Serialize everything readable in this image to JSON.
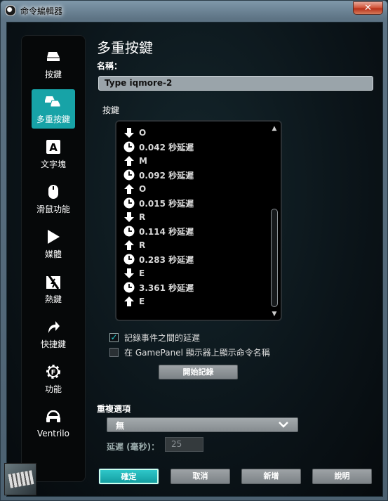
{
  "window": {
    "title": "命令編輯器",
    "close_label": "✕"
  },
  "sidebar": {
    "items": [
      {
        "label": "按鍵",
        "icon": "key-icon",
        "active": false
      },
      {
        "label": "多重按鍵",
        "icon": "multikey-icon",
        "active": true
      },
      {
        "label": "文字塊",
        "icon": "text-block-icon",
        "active": false
      },
      {
        "label": "滑鼠功能",
        "icon": "mouse-icon",
        "active": false
      },
      {
        "label": "媒體",
        "icon": "play-icon",
        "active": false
      },
      {
        "label": "熱鍵",
        "icon": "hotkey-icon",
        "active": false
      },
      {
        "label": "快捷鍵",
        "icon": "shortcut-arrow-icon",
        "active": false
      },
      {
        "label": "功能",
        "icon": "function-gear-icon",
        "active": false
      },
      {
        "label": "Ventrilo",
        "icon": "headset-icon",
        "active": false
      }
    ]
  },
  "main": {
    "title": "多重按鍵",
    "name_label": "名稱：",
    "name_value": "Type iqmore-2",
    "keys_label": "按鍵",
    "key_events": [
      {
        "type": "down",
        "text": "O"
      },
      {
        "type": "delay",
        "text": "0.042 秒延遲"
      },
      {
        "type": "up",
        "text": "M"
      },
      {
        "type": "delay",
        "text": "0.092 秒延遲"
      },
      {
        "type": "up",
        "text": "O"
      },
      {
        "type": "delay",
        "text": "0.015 秒延遲"
      },
      {
        "type": "down",
        "text": "R"
      },
      {
        "type": "delay",
        "text": "0.114 秒延遲"
      },
      {
        "type": "up",
        "text": "R"
      },
      {
        "type": "delay",
        "text": "0.283 秒延遲"
      },
      {
        "type": "down",
        "text": "E"
      },
      {
        "type": "delay",
        "text": "3.361 秒延遲"
      },
      {
        "type": "up",
        "text": "E"
      }
    ],
    "record_delays": {
      "label": "記錄事件之間的延遲",
      "checked": true
    },
    "show_gamepanel": {
      "label": "在 GamePanel 顯示器上顯示命令名稱",
      "checked": false
    },
    "start_record_label": "開始記錄",
    "repeat_label": "重複選項",
    "repeat_value": "無",
    "delay_label": "延遲 (毫秒)：",
    "delay_value": "25"
  },
  "footer": {
    "ok_label": "確定",
    "cancel_label": "取消",
    "new_label": "新增",
    "help_label": "說明"
  },
  "colors": {
    "accent": "#17a3a7",
    "background": "#0b1419"
  }
}
